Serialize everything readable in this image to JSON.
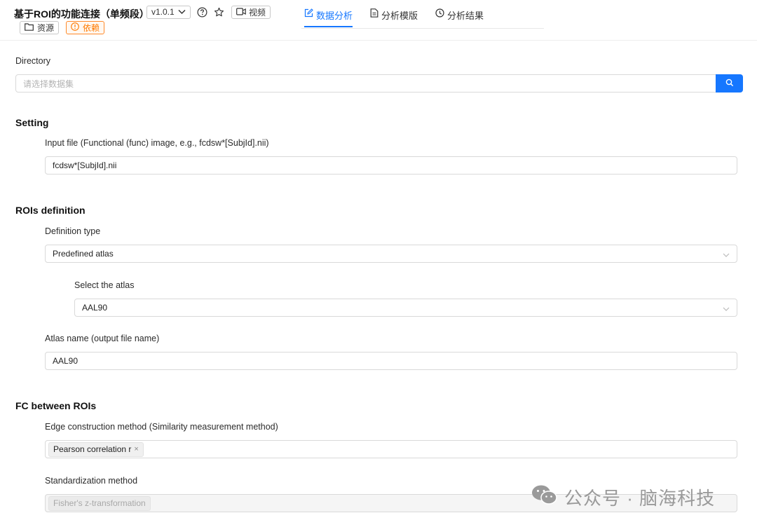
{
  "header": {
    "title": "基于ROI的功能连接（单频段）",
    "version": "v1.0.1",
    "video_label": "视频",
    "resources_label": "资源",
    "dependencies_label": "依赖",
    "tabs": [
      {
        "label": "数据分析",
        "icon": "edit-icon",
        "active": true
      },
      {
        "label": "分析模版",
        "icon": "file-icon",
        "active": false
      },
      {
        "label": "分析结果",
        "icon": "clock-icon",
        "active": false
      }
    ],
    "colors": {
      "accent": "#1677ff",
      "warning": "#ff7a00"
    }
  },
  "directory": {
    "label": "Directory",
    "placeholder": "请选择数据集"
  },
  "setting": {
    "title": "Setting",
    "input_file_label": "Input file (Functional (func) image, e.g., fcdsw*[SubjId].nii)",
    "input_file_value": "fcdsw*[SubjId].nii"
  },
  "rois": {
    "title": "ROIs definition",
    "definition_type_label": "Definition type",
    "definition_type_value": "Predefined atlas",
    "select_atlas_label": "Select the atlas",
    "select_atlas_value": "AAL90",
    "atlas_name_label": "Atlas name (output file name)",
    "atlas_name_value": "AAL90"
  },
  "fc": {
    "title": "FC between ROIs",
    "edge_method_label": "Edge construction method (Similarity measurement method)",
    "edge_method_tag": "Pearson correlation r",
    "standardization_label": "Standardization method",
    "standardization_tag": "Fisher's z-transformation"
  },
  "watermark": {
    "text": "公众号 · 脑海科技"
  }
}
